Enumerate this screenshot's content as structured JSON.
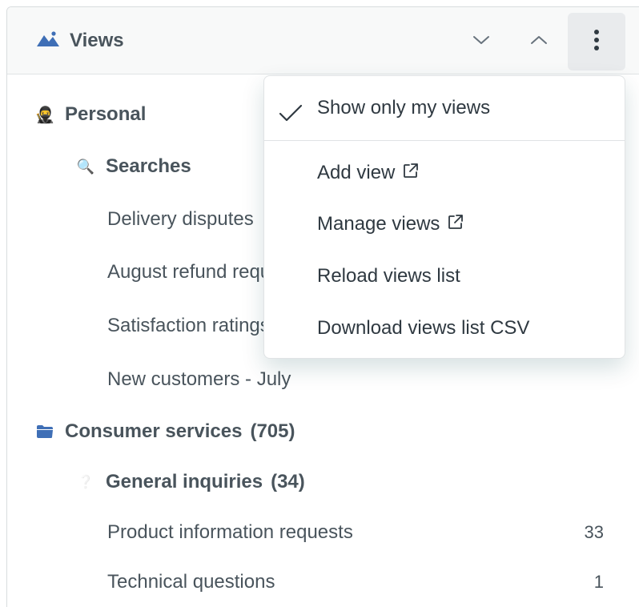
{
  "header": {
    "title": "Views",
    "icon": "mountain-views-icon",
    "buttons": {
      "collapse": "chevron-down-icon",
      "expand": "chevron-up-icon",
      "more": "vertical-ellipsis-icon"
    }
  },
  "tree": {
    "personal": {
      "label": "Personal",
      "icon": "ninja-emoji-icon",
      "glyph": "🥷"
    },
    "searches": {
      "label": "Searches",
      "icon": "magnifier-emoji-icon",
      "glyph": "🔍"
    },
    "search_items": [
      {
        "label": "Delivery disputes"
      },
      {
        "label": "August refund requests"
      },
      {
        "label": "Satisfaction ratings"
      },
      {
        "label": "New customers - July"
      }
    ],
    "consumer_services": {
      "label": "Consumer services",
      "count": "(705)",
      "icon": "folder-icon"
    },
    "general_inquiries": {
      "label": "General inquiries",
      "count": "(34)",
      "icon": "question-emoji-icon",
      "glyph": "❔"
    },
    "inquiry_items": [
      {
        "label": "Product information requests",
        "count": "33"
      },
      {
        "label": "Technical questions",
        "count": "1"
      }
    ]
  },
  "menu": {
    "items": [
      {
        "label": "Show only my views",
        "checked": true
      },
      {
        "label": "Add view",
        "external": true
      },
      {
        "label": "Manage views",
        "external": true
      },
      {
        "label": "Reload views list",
        "external": false
      },
      {
        "label": "Download views list CSV",
        "external": false
      }
    ]
  },
  "colors": {
    "accent_blue": "#3f6fb6",
    "text": "#49545c",
    "header_bg": "#f8f9f9",
    "button_active_bg": "#e9ebed"
  }
}
